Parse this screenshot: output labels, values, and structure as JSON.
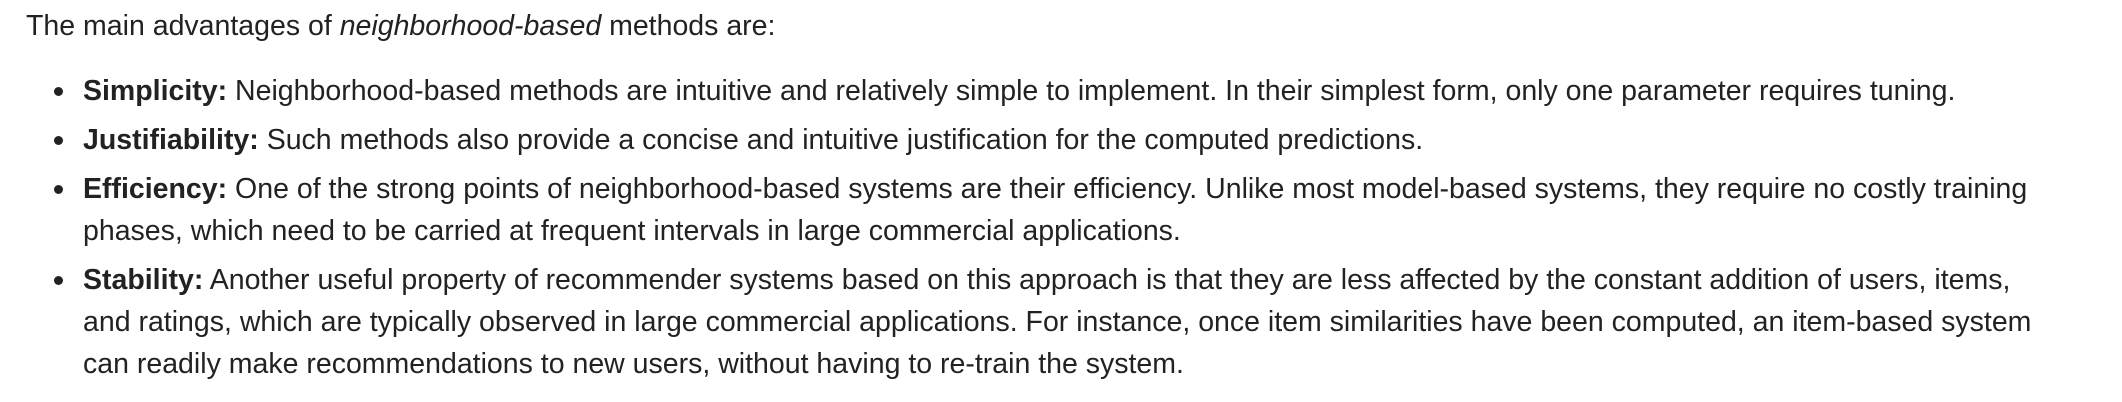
{
  "intro": {
    "prefix": "The main advantages of ",
    "emphasis": "neighborhood-based",
    "suffix": " methods are:"
  },
  "advantages": [
    {
      "term": "Simplicity:",
      "text": " Neighborhood-based methods are intuitive and relatively simple to implement. In their simplest form, only one parameter requires tuning."
    },
    {
      "term": "Justifiability:",
      "text": " Such methods also provide a concise and intuitive justification for the computed predictions."
    },
    {
      "term": "Efficiency:",
      "text": " One of the strong points of neighborhood-based systems are their efficiency. Unlike most model-based systems, they require no costly training phases, which need to be carried at frequent intervals in large commercial applications."
    },
    {
      "term": "Stability:",
      "text": " Another useful property of recommender systems based on this approach is that they are less affected by the constant addition of users, items, and ratings, which are typically observed in large commercial applications. For instance, once item similarities have been computed, an item-based system can readily make recommendations to new users, without having to re-train the system."
    }
  ]
}
